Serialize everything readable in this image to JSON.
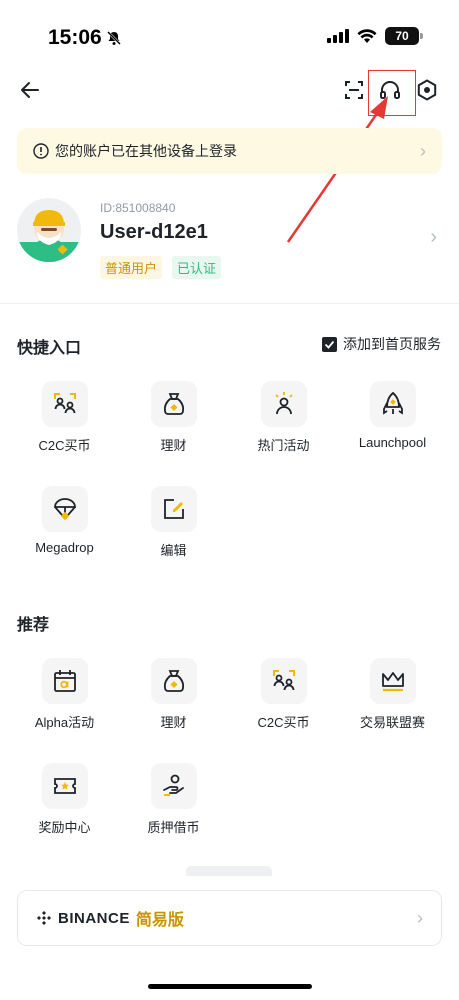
{
  "status_bar": {
    "time": "15:06",
    "battery": "70"
  },
  "notice": {
    "text": "您的账户已在其他设备上登录"
  },
  "profile": {
    "uid": "ID:851008840",
    "username": "User-d12e1",
    "badge_level": "普通用户",
    "badge_verified": "已认证"
  },
  "quick_access": {
    "title": "快捷入口",
    "add_to_home": "添加到首页服务",
    "items": [
      {
        "label": "C2C买币",
        "icon": "c2c-icon"
      },
      {
        "label": "理财",
        "icon": "earn-bag-icon"
      },
      {
        "label": "热门活动",
        "icon": "hot-activity-icon"
      },
      {
        "label": "Launchpool",
        "icon": "rocket-icon"
      },
      {
        "label": "Megadrop",
        "icon": "parachute-icon"
      },
      {
        "label": "编辑",
        "icon": "edit-icon"
      }
    ]
  },
  "recommended": {
    "title": "推荐",
    "items": [
      {
        "label": "Alpha活动",
        "icon": "alpha-calendar-icon"
      },
      {
        "label": "理财",
        "icon": "earn-bag-icon"
      },
      {
        "label": "C2C买币",
        "icon": "c2c-icon"
      },
      {
        "label": "交易联盟赛",
        "icon": "crown-icon"
      },
      {
        "label": "奖励中心",
        "icon": "reward-ticket-icon"
      },
      {
        "label": "质押借币",
        "icon": "pledge-loan-icon"
      }
    ]
  },
  "binance_lite": {
    "brand": "BINANCE",
    "label": "简易版"
  },
  "colors": {
    "accent": "#F0B90B",
    "verified": "#2EBD85",
    "annotation": "#E53935"
  }
}
